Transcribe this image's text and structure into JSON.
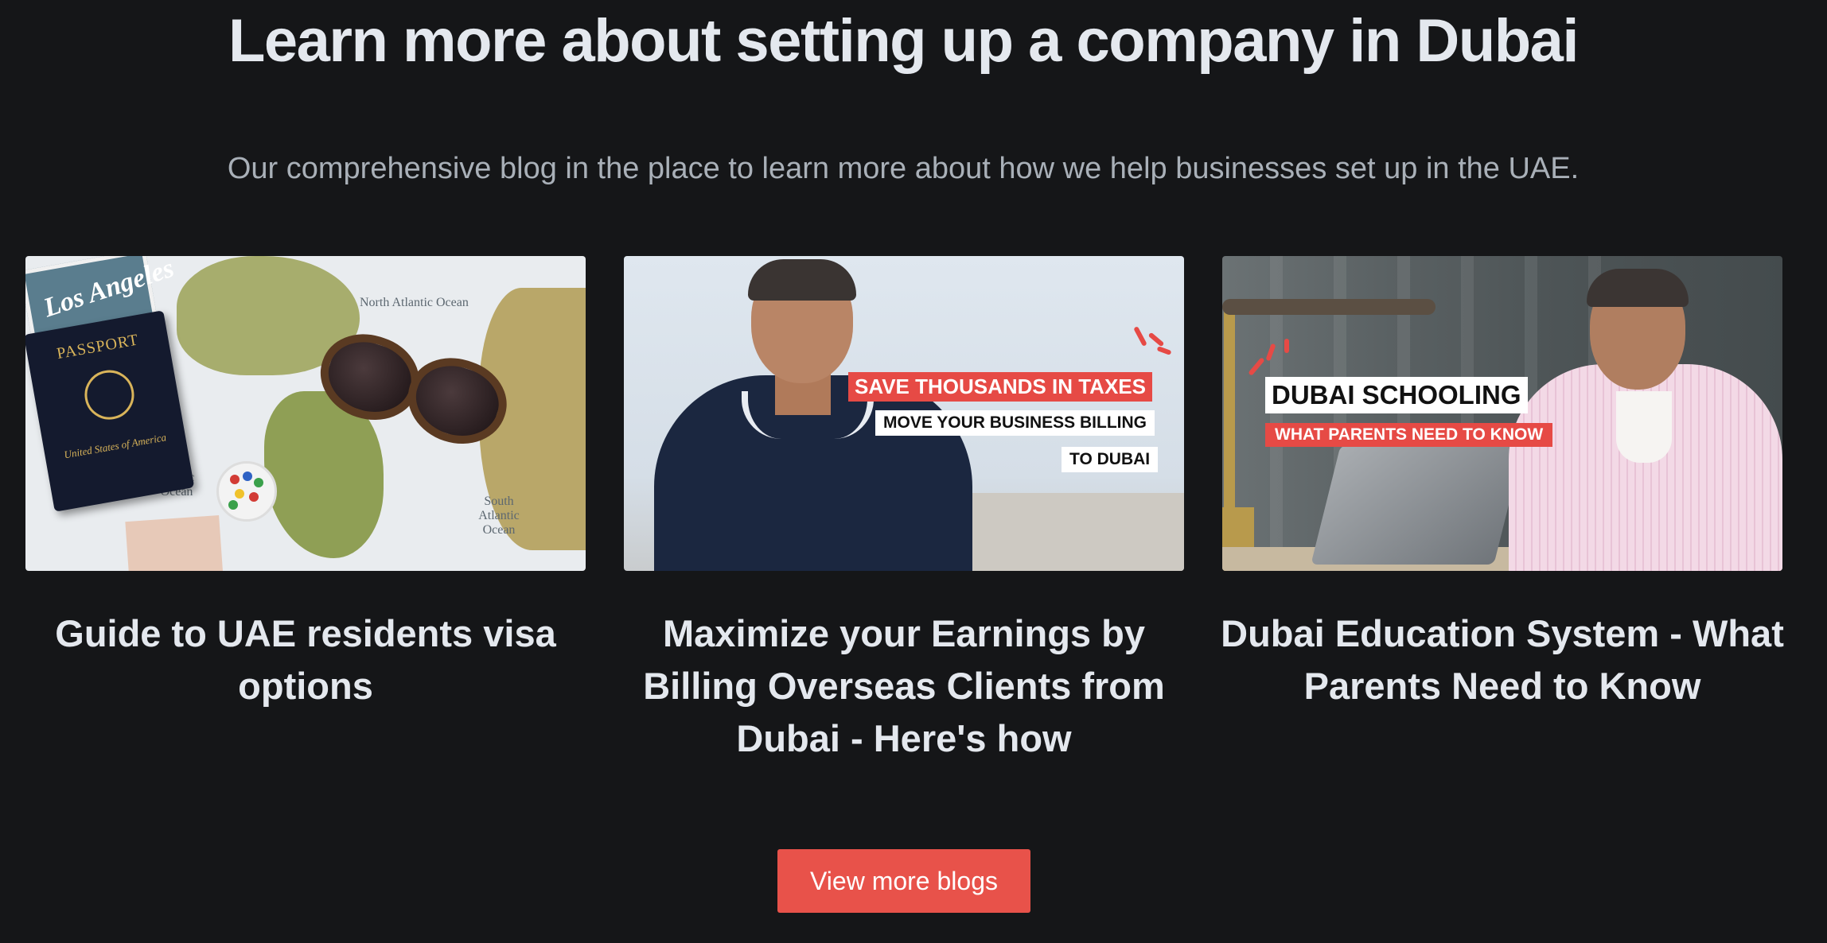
{
  "header": {
    "title": "Learn more about setting up a company in Dubai",
    "subtitle": "Our comprehensive blog in the place to learn more about how we help businesses set up in the UAE."
  },
  "posts": [
    {
      "title": "Guide to UAE residents visa options",
      "image": {
        "postcard_text": "Los Angeles",
        "passport_text": "PASSPORT",
        "passport_country": "United States of America",
        "map_labels": [
          "North Atlantic Ocean",
          "South Atlantic Ocean",
          "Pacific Ocean"
        ]
      }
    },
    {
      "title": "Maximize your Earnings by Billing Overseas Clients from Dubai - Here's how",
      "image": {
        "headline": "SAVE THOUSANDS IN TAXES",
        "line1": "MOVE YOUR BUSINESS BILLING",
        "line2": "TO DUBAI"
      }
    },
    {
      "title": "Dubai Education System - What Parents Need to Know",
      "image": {
        "headline": "DUBAI SCHOOLING",
        "subline": "WHAT PARENTS NEED TO KNOW"
      }
    }
  ],
  "cta": {
    "label": "View more blogs"
  },
  "colors": {
    "background": "#151618",
    "accent": "#e8524a",
    "heading": "#e4e8ee",
    "subtitle": "#a9b0b8"
  }
}
